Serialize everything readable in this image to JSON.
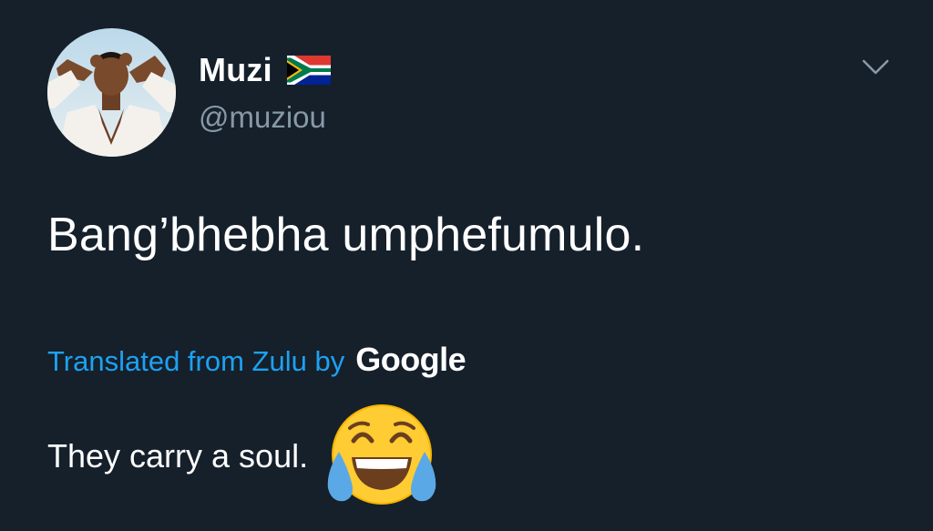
{
  "author": {
    "display_name": "Muzi",
    "handle": "@muziou",
    "avatar_icon": "profile-photo",
    "flag_icon": "south-africa-flag-icon"
  },
  "menu": {
    "icon": "chevron-down-icon"
  },
  "tweet": {
    "text": "Bang’bhebha umphefumulo."
  },
  "translation": {
    "label": "Translated from Zulu by",
    "provider": "Google",
    "text": "They carry a soul.",
    "emoji": "face-with-tears-of-joy-icon"
  },
  "colors": {
    "background": "#15202b",
    "primary_text": "#ffffff",
    "secondary_text": "#8899a6",
    "link": "#1da1f2"
  }
}
